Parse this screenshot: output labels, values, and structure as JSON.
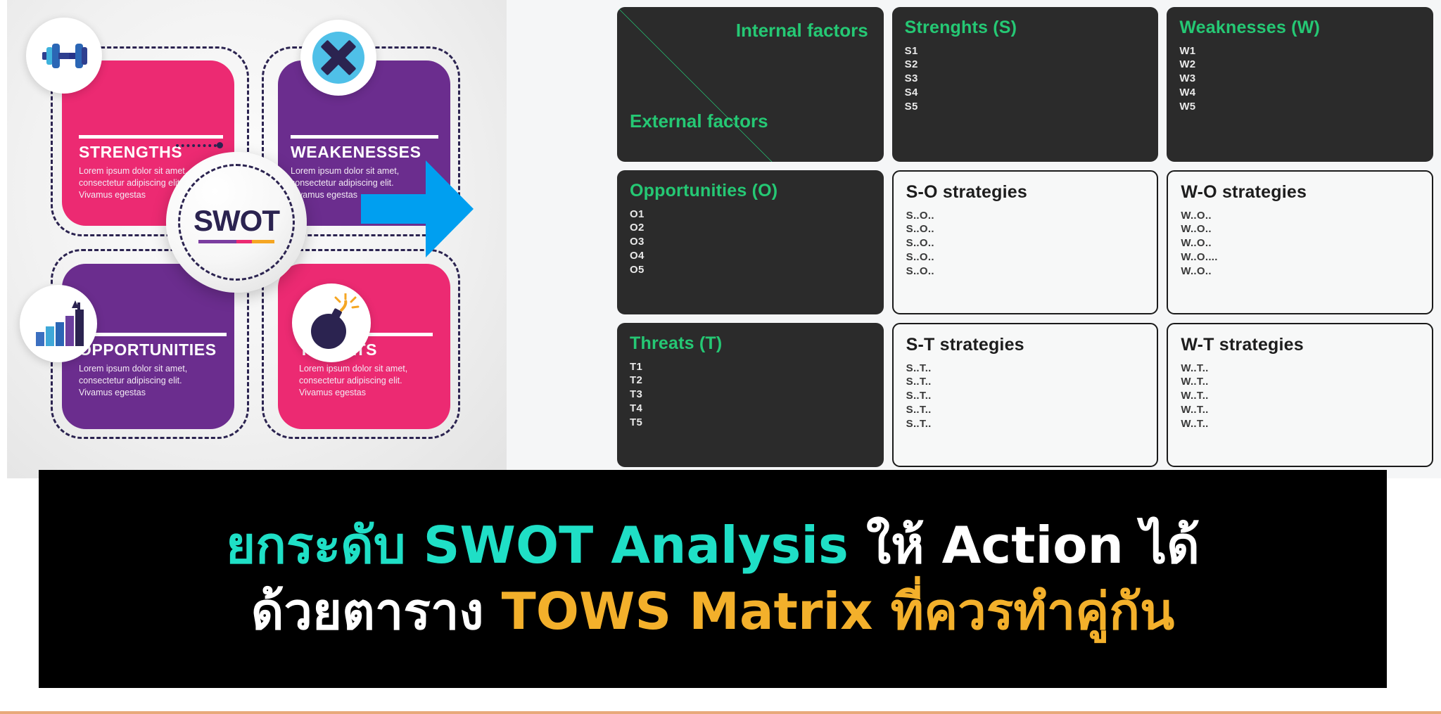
{
  "swot_infographic": {
    "center_logo": "SWOT",
    "quadrants": [
      {
        "key": "strengths",
        "title": "STRENGTHS",
        "desc": "Lorem ipsum dolor sit amet, consectetur adipiscing elit. Vivamus egestas",
        "color": "#ec2a72",
        "icon": "dumbbell-icon"
      },
      {
        "key": "weaknesses",
        "title": "WEAKENESSES",
        "desc": "Lorem ipsum dolor sit amet, consectetur adipiscing elit. Vivamus egestas",
        "color": "#6b2d8e",
        "icon": "cross-mark-icon"
      },
      {
        "key": "opportunities",
        "title": "OPPORTUNITIES",
        "desc": "Lorem ipsum dolor sit amet, consectetur adipiscing elit. Vivamus egestas",
        "color": "#6b2d8e",
        "icon": "growth-bar-chart-icon"
      },
      {
        "key": "threats",
        "title": "THREATS",
        "desc": "Lorem ipsum dolor sit amet, consectetur adipiscing elit. Vivamus egestas",
        "color": "#ec2a72",
        "icon": "bomb-icon"
      }
    ],
    "arrow": {
      "icon": "right-arrow-icon",
      "color": "#009ff0"
    }
  },
  "tows_matrix": {
    "corner": {
      "internal_label": "Internal factors",
      "external_label": "External factors",
      "diagonal_color": "#25c874"
    },
    "column_headers": [
      {
        "title": "Strenghts (S)",
        "items": [
          "S1",
          "S2",
          "S3",
          "S4",
          "S5"
        ]
      },
      {
        "title": "Weaknesses (W)",
        "items": [
          "W1",
          "W2",
          "W3",
          "W4",
          "W5"
        ]
      }
    ],
    "row_headers": [
      {
        "title": "Opportunities (O)",
        "items": [
          "O1",
          "O2",
          "O3",
          "O4",
          "O5"
        ]
      },
      {
        "title": "Threats (T)",
        "items": [
          "T1",
          "T2",
          "T3",
          "T4",
          "T5"
        ]
      }
    ],
    "strategies": [
      {
        "title": "S-O strategies",
        "items": [
          "S..O..",
          "S..O..",
          "S..O..",
          "S..O..",
          "S..O.."
        ]
      },
      {
        "title": "W-O strategies",
        "items": [
          "W..O..",
          "W..O..",
          "W..O..",
          "W..O....",
          "W..O.."
        ]
      },
      {
        "title": "S-T strategies",
        "items": [
          "S..T..",
          "S..T..",
          "S..T..",
          "S..T..",
          "S..T.."
        ]
      },
      {
        "title": "W-T strategies",
        "items": [
          "W..T..",
          "W..T..",
          "W..T..",
          "W..T..",
          "W..T.."
        ]
      }
    ],
    "colors": {
      "dark_cell": "#2b2b2b",
      "accent_green": "#25c874",
      "light_cell": "#f7f8f8"
    }
  },
  "caption": {
    "line1_part1": "ยกระดับ SWOT Analysis",
    "line1_part2": "ให้ Action ได้",
    "line2_part1": "ด้วยตาราง",
    "line2_part2": "TOWS Matrix ที่ควรทำคู่กัน",
    "colors": {
      "cyan": "#1fdfc6",
      "white": "#ffffff",
      "amber": "#f3b02b",
      "background": "#000000"
    }
  }
}
